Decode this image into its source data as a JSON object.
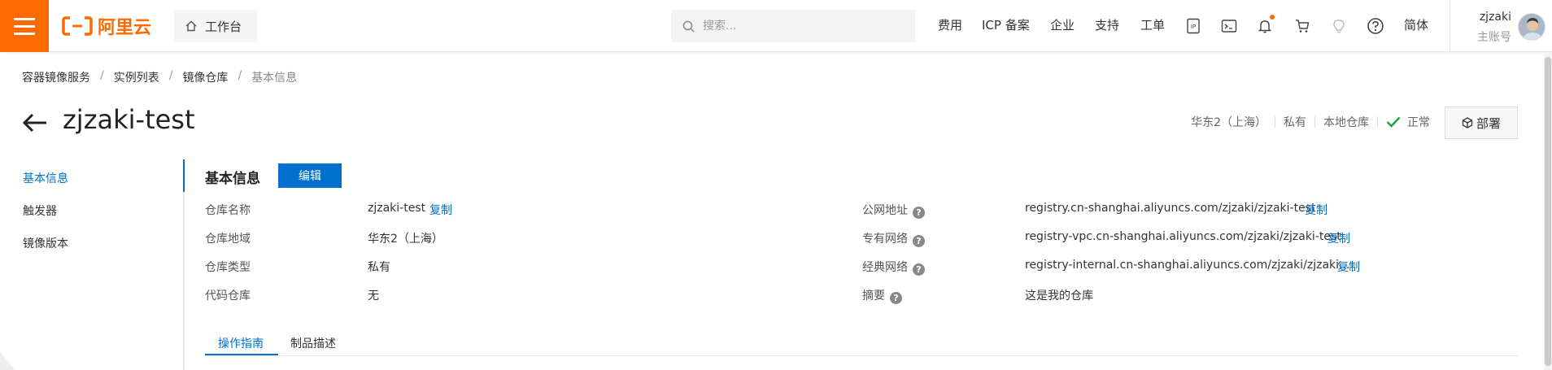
{
  "topbar": {
    "logo_text": "阿里云",
    "workbench_label": "工作台",
    "search_placeholder": "搜索...",
    "nav": [
      "费用",
      "ICP 备案",
      "企业",
      "支持",
      "工单"
    ],
    "lang": "简体",
    "user_name": "zjzaki",
    "user_sub": "主账号",
    "brand_color": "#ff6a00"
  },
  "breadcrumb": [
    "容器镜像服务",
    "实例列表",
    "镜像仓库",
    "基本信息"
  ],
  "header": {
    "title": "zjzaki-test",
    "region": "华东2（上海）",
    "visibility": "私有",
    "repo_type": "本地仓库",
    "status": "正常",
    "deploy_label": "部署"
  },
  "sidenav": {
    "items": [
      "基本信息",
      "触发器",
      "镜像版本"
    ]
  },
  "section": {
    "title": "基本信息",
    "edit_label": "编辑",
    "copy_label": "复制",
    "left_rows": [
      {
        "label": "仓库名称",
        "value": "zjzaki-test"
      },
      {
        "label": "仓库地域",
        "value": "华东2（上海）"
      },
      {
        "label": "仓库类型",
        "value": "私有"
      },
      {
        "label": "代码仓库",
        "value": "无"
      }
    ],
    "right_rows": [
      {
        "label": "公网地址",
        "value": "registry.cn-shanghai.aliyuncs.com/zjzaki/zjzaki-test"
      },
      {
        "label": "专有网络",
        "value": "registry-vpc.cn-shanghai.aliyuncs.com/zjzaki/zjzaki-test"
      },
      {
        "label": "经典网络",
        "value": "registry-internal.cn-shanghai.aliyuncs.com/zjzaki/zjzaki..."
      },
      {
        "label": "摘要",
        "value": "这是我的仓库"
      }
    ]
  },
  "tabs": [
    "操作指南",
    "制品描述"
  ],
  "accent_color": "#0070cc"
}
